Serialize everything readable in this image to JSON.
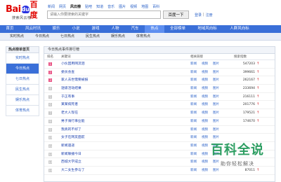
{
  "logo": {
    "bai": "Bai",
    "paw": "du",
    "cn": "百度",
    "sub": "搜索风云榜"
  },
  "topnav": [
    "新闻",
    "网页",
    "风云榜",
    "贴吧",
    "知道",
    "音乐",
    "图片",
    "视频",
    "地图",
    "百科"
  ],
  "topnav_current": 2,
  "search": {
    "placeholder": "请输入你要搜索的关键字",
    "button": "百度一下"
  },
  "auth": {
    "login": "登录",
    "sep": "|",
    "register": "注册"
  },
  "mainnav": [
    "首页",
    "风云时讯",
    "娱乐",
    "小说",
    "游戏",
    "人物",
    "汽车",
    "热点",
    "全部榜单",
    "地域风向标",
    "人群风向标"
  ],
  "mainnav_current": 7,
  "subnav": [
    "实时热点",
    "今日热点",
    "七日热点",
    "民生热点",
    "娱乐热点",
    "体育热点"
  ],
  "sidebar": {
    "title": "热点榜单首页",
    "items": [
      "实时热点",
      "今日热点",
      "七日热点",
      "民生热点",
      "娱乐热点",
      "体育热点"
    ],
    "active": 1
  },
  "panel": {
    "title": "今日热点事件排行榜",
    "columns": {
      "rank": "排名",
      "keyword": "关键词",
      "links": "相关链接",
      "index": "搜索指数"
    }
  },
  "link_labels": [
    "新闻",
    "视频",
    "图片"
  ],
  "rows": [
    {
      "rank": "1",
      "keyword": "小伙因用网流泪",
      "index": "547203"
    },
    {
      "rank": "2",
      "keyword": "委员会查",
      "index": "399661"
    },
    {
      "rank": "3",
      "keyword": "家人去世需要被报",
      "index": "262167"
    },
    {
      "rank": "4",
      "keyword": "逐级活动结果",
      "index": "233694"
    },
    {
      "rank": "5",
      "keyword": "于正有事",
      "index": "216111"
    },
    {
      "rank": "6",
      "keyword": "某某病死者",
      "index": "201776"
    },
    {
      "rank": "7",
      "keyword": "老大人现在",
      "index": "179521"
    },
    {
      "rank": "8",
      "keyword": "男子骑行事业能",
      "index": "174670"
    },
    {
      "rank": "9",
      "keyword": "我真的不好了",
      "index": ""
    },
    {
      "rank": "10",
      "keyword": "女子在网友面前",
      "index": ""
    },
    {
      "rank": "11",
      "keyword": "新闻速递",
      "index": ""
    },
    {
      "rank": "12",
      "keyword": "新闻联播今日",
      "index": ""
    },
    {
      "rank": "13",
      "keyword": "西城大学成立",
      "index": ""
    },
    {
      "rank": "14",
      "keyword": "大二女生参与了",
      "index": "87011"
    }
  ],
  "watermark": {
    "title": "百科全说",
    "subtitle": "助你轻松解决"
  },
  "colors": {
    "brand_red": "#e10601",
    "nav_blue": "#3a6fd8",
    "link_blue": "#2d63c8",
    "top_rank": "#e85384",
    "trend_up": "#d2171e"
  }
}
